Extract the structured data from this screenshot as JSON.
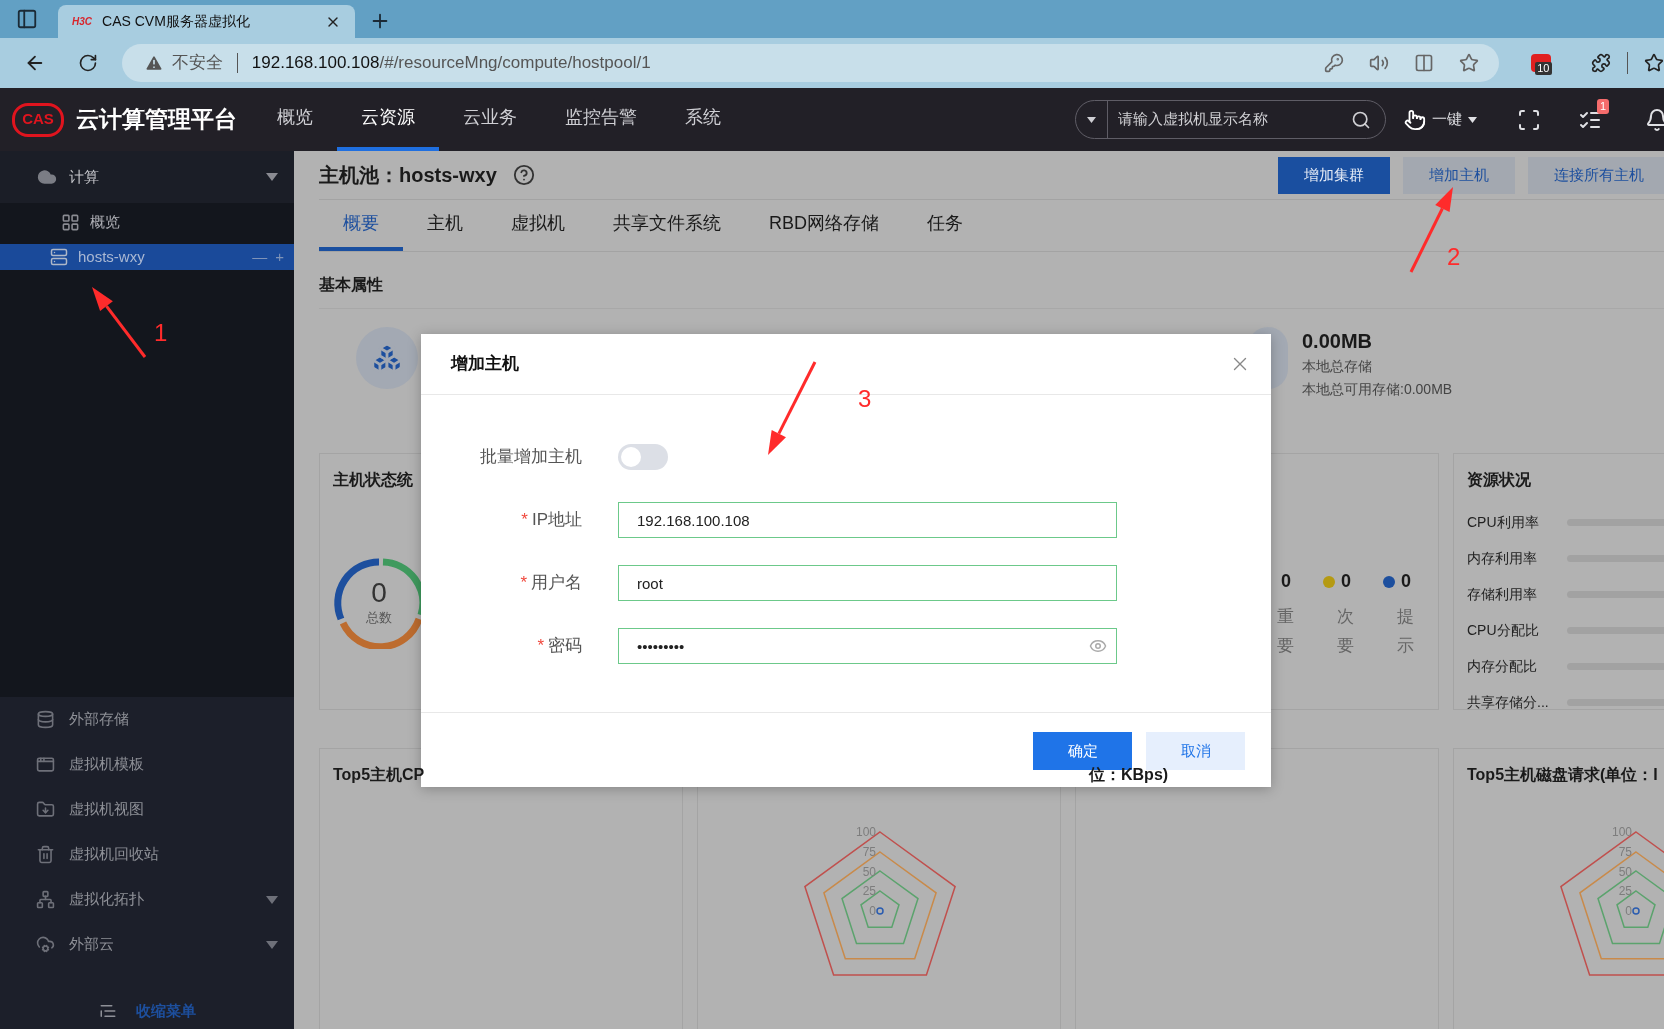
{
  "browser": {
    "favicon": "H3C",
    "tab_title": "CAS CVM服务器虚拟化",
    "security": "不安全",
    "url_host": "192.168.100.108",
    "url_path": "/#/resourceMng/compute/hostpool/1",
    "extension_badge": "10"
  },
  "header": {
    "logo": "CAS",
    "title": "云计算管理平台",
    "nav": [
      {
        "label": "概览",
        "selected": false
      },
      {
        "label": "云资源",
        "selected": true
      },
      {
        "label": "云业务",
        "selected": false
      },
      {
        "label": "监控告警",
        "selected": false
      },
      {
        "label": "系统",
        "selected": false
      }
    ],
    "search": {
      "placeholder": "请输入虚拟机显示名称"
    },
    "one_click": "一键",
    "tasks_badge": "1"
  },
  "sidebar": {
    "compute": {
      "label": "计算",
      "expanded": true,
      "children": [
        {
          "label": "概览",
          "selected": false
        },
        {
          "label": "hosts-wxy",
          "selected": true,
          "actions": [
            "—",
            "+"
          ]
        }
      ]
    },
    "items": [
      {
        "label": "外部存储",
        "has_submenu": false
      },
      {
        "label": "虚拟机模板",
        "has_submenu": false
      },
      {
        "label": "虚拟机视图",
        "has_submenu": false
      },
      {
        "label": "虚拟机回收站",
        "has_submenu": false
      },
      {
        "label": "虚拟化拓扑",
        "has_submenu": true
      },
      {
        "label": "外部云",
        "has_submenu": true
      }
    ],
    "collapse": "收缩菜单"
  },
  "page": {
    "title": "主机池：hosts-wxy",
    "buttons": [
      {
        "label": "增加集群",
        "primary": true
      },
      {
        "label": "增加主机",
        "primary": false
      },
      {
        "label": "连接所有主机",
        "primary": false
      }
    ],
    "tabs": [
      {
        "label": "概要",
        "selected": true
      },
      {
        "label": "主机",
        "selected": false
      },
      {
        "label": "虚拟机",
        "selected": false
      },
      {
        "label": "共享文件系统",
        "selected": false
      },
      {
        "label": "RBD网络存储",
        "selected": false
      },
      {
        "label": "任务",
        "selected": false
      }
    ],
    "section": "基本属性",
    "storage": {
      "value": "0.00MB",
      "label": "本地总存储",
      "available": "本地总可用存储:0.00MB"
    },
    "host_status": {
      "title": "主机状态统",
      "total": "0",
      "total_label": "总数"
    },
    "alarms": [
      {
        "count": "0",
        "label": "重要"
      },
      {
        "count": "0",
        "label": "次要",
        "color": "#b59a12"
      },
      {
        "count": "0",
        "label": "提示",
        "color": "#1d4f9e"
      }
    ],
    "resources": {
      "title": "资源状况",
      "items": [
        {
          "label": "CPU利用率",
          "level": 0
        },
        {
          "label": "内存利用率",
          "level": 0
        },
        {
          "label": "存储利用率",
          "level": 0
        },
        {
          "label": "CPU分配比",
          "level": 0
        },
        {
          "label": "内存分配比",
          "level": 0
        },
        {
          "label": "共享存储分...",
          "level": 0
        }
      ]
    },
    "charts": [
      {
        "title": "Top5主机CP"
      },
      {
        "ticks": [
          "100",
          "75",
          "50",
          "25",
          "0"
        ]
      },
      {
        "title": "位：KBps)"
      },
      {
        "title": "Top5主机磁盘请求(单位：I",
        "ticks": [
          "100",
          "75",
          "50",
          "25",
          "0"
        ]
      }
    ]
  },
  "modal": {
    "title": "增加主机",
    "required_mark": "*",
    "fields": [
      {
        "kind": "toggle",
        "label": "批量增加主机",
        "on": false
      },
      {
        "kind": "text",
        "label": "IP地址",
        "required": true,
        "value": "192.168.100.108"
      },
      {
        "kind": "text",
        "label": "用户名",
        "required": true,
        "value": "root"
      },
      {
        "kind": "password",
        "label": "密码",
        "required": true,
        "value": "•••••••••"
      }
    ],
    "buttons": [
      {
        "label": "确定",
        "primary": true
      },
      {
        "label": "取消",
        "primary": false
      }
    ]
  },
  "annotations": [
    {
      "label": "1"
    },
    {
      "label": "2"
    },
    {
      "label": "3"
    }
  ]
}
